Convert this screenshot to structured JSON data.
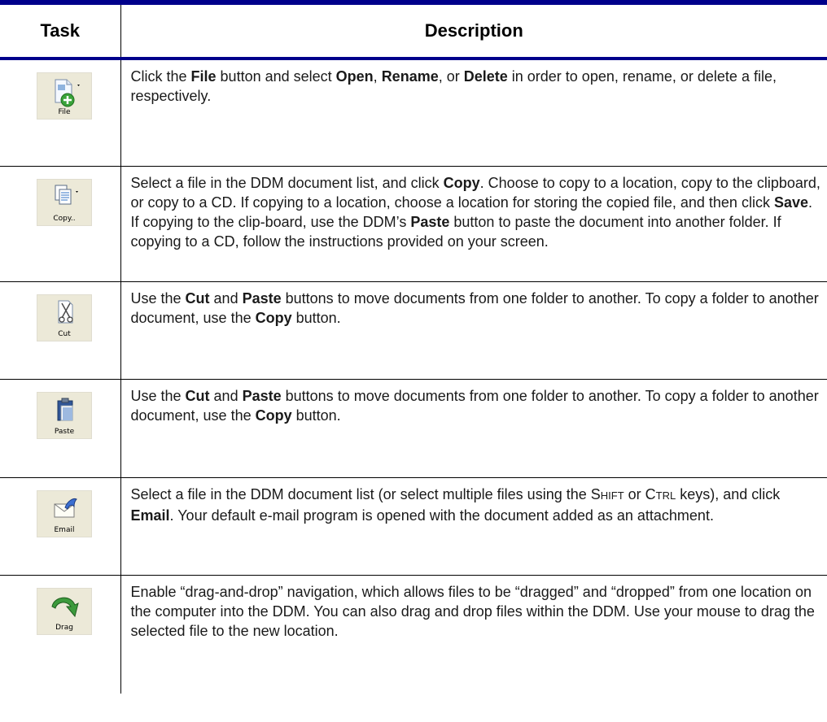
{
  "header": {
    "task": "Task",
    "description": "Description"
  },
  "rows": [
    {
      "icon": "file-icon",
      "button_label": "File",
      "segments": [
        {
          "t": "Click the ",
          "b": false
        },
        {
          "t": "File",
          "b": true
        },
        {
          "t": " button and select ",
          "b": false
        },
        {
          "t": "Open",
          "b": true
        },
        {
          "t": ", ",
          "b": false
        },
        {
          "t": "Rename",
          "b": true
        },
        {
          "t": ", or ",
          "b": false
        },
        {
          "t": "Delete",
          "b": true
        },
        {
          "t": " in order to open, rename, or delete a file, respectively.",
          "b": false
        }
      ]
    },
    {
      "icon": "copy-icon",
      "button_label": "Copy..",
      "segments": [
        {
          "t": "Select a file in the DDM document list, and click ",
          "b": false
        },
        {
          "t": "Copy",
          "b": true
        },
        {
          "t": ". Choose to copy to a location, copy to the clipboard, or copy to a CD. If copying to a location, choose a location for storing the copied file, and then click ",
          "b": false
        },
        {
          "t": "Save",
          "b": true
        },
        {
          "t": ". If copying to the clip-board, use the DDM’s ",
          "b": false
        },
        {
          "t": "Paste",
          "b": true
        },
        {
          "t": " button to paste the document into another folder. If copying to a CD, follow the instructions provided on your screen.",
          "b": false
        }
      ]
    },
    {
      "icon": "cut-icon",
      "button_label": "Cut",
      "segments": [
        {
          "t": "Use the ",
          "b": false
        },
        {
          "t": "Cut",
          "b": true
        },
        {
          "t": " and ",
          "b": false
        },
        {
          "t": "Paste",
          "b": true
        },
        {
          "t": " buttons to move documents from one folder to another. To copy a folder to another document, use the ",
          "b": false
        },
        {
          "t": "Copy",
          "b": true
        },
        {
          "t": " button.",
          "b": false
        }
      ]
    },
    {
      "icon": "paste-icon",
      "button_label": "Paste",
      "segments": [
        {
          "t": "Use the ",
          "b": false
        },
        {
          "t": "Cut",
          "b": true
        },
        {
          "t": " and ",
          "b": false
        },
        {
          "t": "Paste",
          "b": true
        },
        {
          "t": " buttons to move documents from one folder to another. To copy a folder to another document, use the ",
          "b": false
        },
        {
          "t": "Copy",
          "b": true
        },
        {
          "t": " button.",
          "b": false
        }
      ]
    },
    {
      "icon": "email-icon",
      "button_label": "Email",
      "segments": [
        {
          "t": "Select a file in the DDM document list (or select multiple files using the ",
          "b": false
        },
        {
          "t": "Shift",
          "sc": true
        },
        {
          "t": " or ",
          "b": false
        },
        {
          "t": "Ctrl",
          "sc": true
        },
        {
          "t": " keys), and click ",
          "b": false
        },
        {
          "t": "Email",
          "b": true
        },
        {
          "t": ". Your default e-mail program is opened with the document added as an attachment.",
          "b": false
        }
      ]
    },
    {
      "icon": "drag-arrow-icon",
      "button_label": "Drag",
      "segments": [
        {
          "t": "Enable “drag-and-drop” navigation, which allows files to be “dragged” and “dropped” from one location on the computer into the DDM. You can also drag and drop files within the DDM. Use your mouse to drag the selected file to the new location.",
          "b": false
        }
      ]
    }
  ],
  "colors": {
    "rule": "#00008b",
    "button_bg": "#ece9d8"
  }
}
